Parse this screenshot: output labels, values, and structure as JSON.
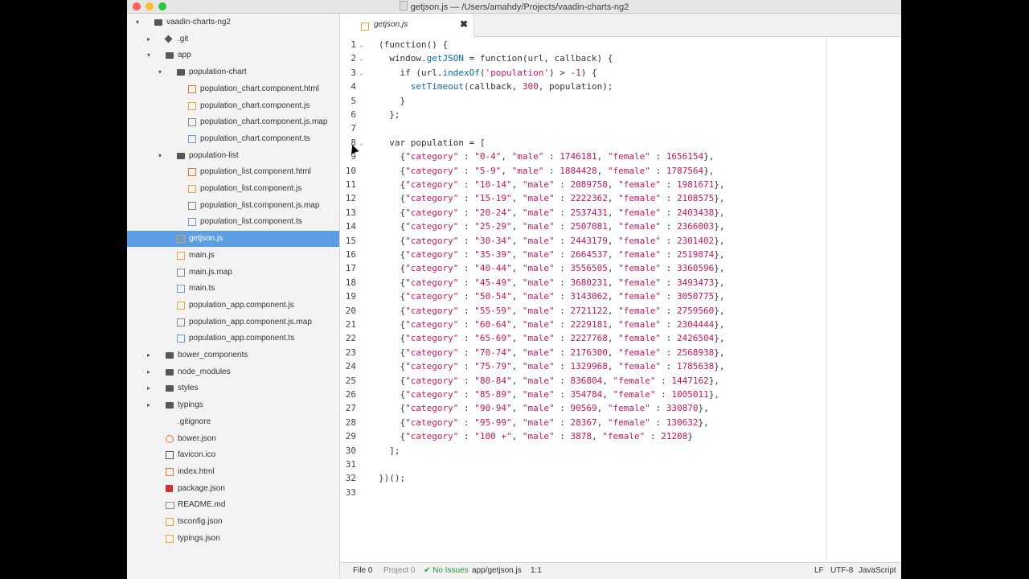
{
  "window": {
    "title": "getjson.js — /Users/amahdy/Projects/vaadin-charts-ng2"
  },
  "sidebar": {
    "items": [
      {
        "label": "vaadin-charts-ng2",
        "icon": "folder-icon",
        "type": "folder",
        "depth": 0,
        "arrow": "▾"
      },
      {
        "label": ".git",
        "icon": "git-icon",
        "type": "git",
        "depth": 1,
        "arrow": "▸"
      },
      {
        "label": "app",
        "icon": "folder-icon",
        "type": "folder",
        "depth": 1,
        "arrow": "▾"
      },
      {
        "label": "population-chart",
        "icon": "folder-icon",
        "type": "folder",
        "depth": 2,
        "arrow": "▾"
      },
      {
        "label": "population_chart.component.html",
        "icon": "html-file-icon",
        "type": "html",
        "depth": 3,
        "arrow": ""
      },
      {
        "label": "population_chart.component.js",
        "icon": "js-file-icon",
        "type": "js",
        "depth": 3,
        "arrow": ""
      },
      {
        "label": "population_chart.component.js.map",
        "icon": "map-file-icon",
        "type": "map",
        "depth": 3,
        "arrow": ""
      },
      {
        "label": "population_chart.component.ts",
        "icon": "ts-file-icon",
        "type": "ts",
        "depth": 3,
        "arrow": ""
      },
      {
        "label": "population-list",
        "icon": "folder-icon",
        "type": "folder",
        "depth": 2,
        "arrow": "▾"
      },
      {
        "label": "population_list.component.html",
        "icon": "html-file-icon",
        "type": "html",
        "depth": 3,
        "arrow": ""
      },
      {
        "label": "population_list.component.js",
        "icon": "js-file-icon",
        "type": "js",
        "depth": 3,
        "arrow": ""
      },
      {
        "label": "population_list.component.js.map",
        "icon": "map-file-icon",
        "type": "map",
        "depth": 3,
        "arrow": ""
      },
      {
        "label": "population_list.component.ts",
        "icon": "ts-file-icon",
        "type": "ts",
        "depth": 3,
        "arrow": ""
      },
      {
        "label": "getjson.js",
        "icon": "js-file-icon",
        "type": "js",
        "depth": 2,
        "arrow": "",
        "selected": true
      },
      {
        "label": "main.js",
        "icon": "js-file-icon",
        "type": "js",
        "depth": 2,
        "arrow": ""
      },
      {
        "label": "main.js.map",
        "icon": "map-file-icon",
        "type": "map",
        "depth": 2,
        "arrow": ""
      },
      {
        "label": "main.ts",
        "icon": "ts-file-icon",
        "type": "ts",
        "depth": 2,
        "arrow": ""
      },
      {
        "label": "population_app.component.js",
        "icon": "js-file-icon",
        "type": "js",
        "depth": 2,
        "arrow": ""
      },
      {
        "label": "population_app.component.js.map",
        "icon": "map-file-icon",
        "type": "map",
        "depth": 2,
        "arrow": ""
      },
      {
        "label": "population_app.component.ts",
        "icon": "ts-file-icon",
        "type": "ts",
        "depth": 2,
        "arrow": ""
      },
      {
        "label": "bower_components",
        "icon": "folder-icon",
        "type": "folder",
        "depth": 1,
        "arrow": "▸"
      },
      {
        "label": "node_modules",
        "icon": "folder-icon",
        "type": "folder",
        "depth": 1,
        "arrow": "▸"
      },
      {
        "label": "styles",
        "icon": "folder-icon",
        "type": "folder",
        "depth": 1,
        "arrow": "▸"
      },
      {
        "label": "typings",
        "icon": "folder-icon",
        "type": "folder",
        "depth": 1,
        "arrow": "▸"
      },
      {
        "label": ".gitignore",
        "icon": "gitignore-icon",
        "type": "gitignore",
        "depth": 1,
        "arrow": ""
      },
      {
        "label": "bower.json",
        "icon": "bower-icon",
        "type": "bower",
        "depth": 1,
        "arrow": ""
      },
      {
        "label": "favicon.ico",
        "icon": "favicon-icon",
        "type": "favicon",
        "depth": 1,
        "arrow": ""
      },
      {
        "label": "index.html",
        "icon": "html-file-icon",
        "type": "html",
        "depth": 1,
        "arrow": ""
      },
      {
        "label": "package.json",
        "icon": "npm-icon",
        "type": "npm",
        "depth": 1,
        "arrow": ""
      },
      {
        "label": "README.md",
        "icon": "markdown-icon",
        "type": "md",
        "depth": 1,
        "arrow": ""
      },
      {
        "label": "tsconfig.json",
        "icon": "json-file-icon",
        "type": "json",
        "depth": 1,
        "arrow": ""
      },
      {
        "label": "typings.json",
        "icon": "json-file-icon",
        "type": "json",
        "depth": 1,
        "arrow": ""
      }
    ]
  },
  "tabs": [
    {
      "label": "getjson.js",
      "close": "✖"
    }
  ],
  "editor": {
    "fold_lines": [
      1,
      2,
      3,
      8
    ],
    "lines": [
      "(function() {",
      "  window.getJSON = function(url, callback) {",
      "    if (url.indexOf('population') > -1) {",
      "      setTimeout(callback, 300, population);",
      "    }",
      "  };",
      "",
      "  var population = [",
      "    {\"category\" : \"0-4\", \"male\" : 1746181, \"female\" : 1656154},",
      "    {\"category\" : \"5-9\", \"male\" : 1884428, \"female\" : 1787564},",
      "    {\"category\" : \"10-14\", \"male\" : 2089758, \"female\" : 1981671},",
      "    {\"category\" : \"15-19\", \"male\" : 2222362, \"female\" : 2108575},",
      "    {\"category\" : \"20-24\", \"male\" : 2537431, \"female\" : 2403438},",
      "    {\"category\" : \"25-29\", \"male\" : 2507081, \"female\" : 2366003},",
      "    {\"category\" : \"30-34\", \"male\" : 2443179, \"female\" : 2301402},",
      "    {\"category\" : \"35-39\", \"male\" : 2664537, \"female\" : 2519874},",
      "    {\"category\" : \"40-44\", \"male\" : 3556505, \"female\" : 3360596},",
      "    {\"category\" : \"45-49\", \"male\" : 3680231, \"female\" : 3493473},",
      "    {\"category\" : \"50-54\", \"male\" : 3143062, \"female\" : 3050775},",
      "    {\"category\" : \"55-59\", \"male\" : 2721122, \"female\" : 2759560},",
      "    {\"category\" : \"60-64\", \"male\" : 2229181, \"female\" : 2304444},",
      "    {\"category\" : \"65-69\", \"male\" : 2227768, \"female\" : 2426504},",
      "    {\"category\" : \"70-74\", \"male\" : 2176300, \"female\" : 2568938},",
      "    {\"category\" : \"75-79\", \"male\" : 1329968, \"female\" : 1785638},",
      "    {\"category\" : \"80-84\", \"male\" : 836804, \"female\" : 1447162},",
      "    {\"category\" : \"85-89\", \"male\" : 354784, \"female\" : 1005011},",
      "    {\"category\" : \"90-94\", \"male\" : 90569, \"female\" : 330870},",
      "    {\"category\" : \"95-99\", \"male\" : 28367, \"female\" : 130632},",
      "    {\"category\" : \"100 +\", \"male\" : 3878, \"female\" : 21208}",
      "  ];",
      "",
      "})();",
      ""
    ]
  },
  "status": {
    "file": "File 0",
    "project": "Project 0",
    "issues": "✔ No Issues",
    "path": "app/getjson.js",
    "position": "1:1",
    "line_ending": "LF",
    "encoding": "UTF-8",
    "grammar": "JavaScript"
  }
}
